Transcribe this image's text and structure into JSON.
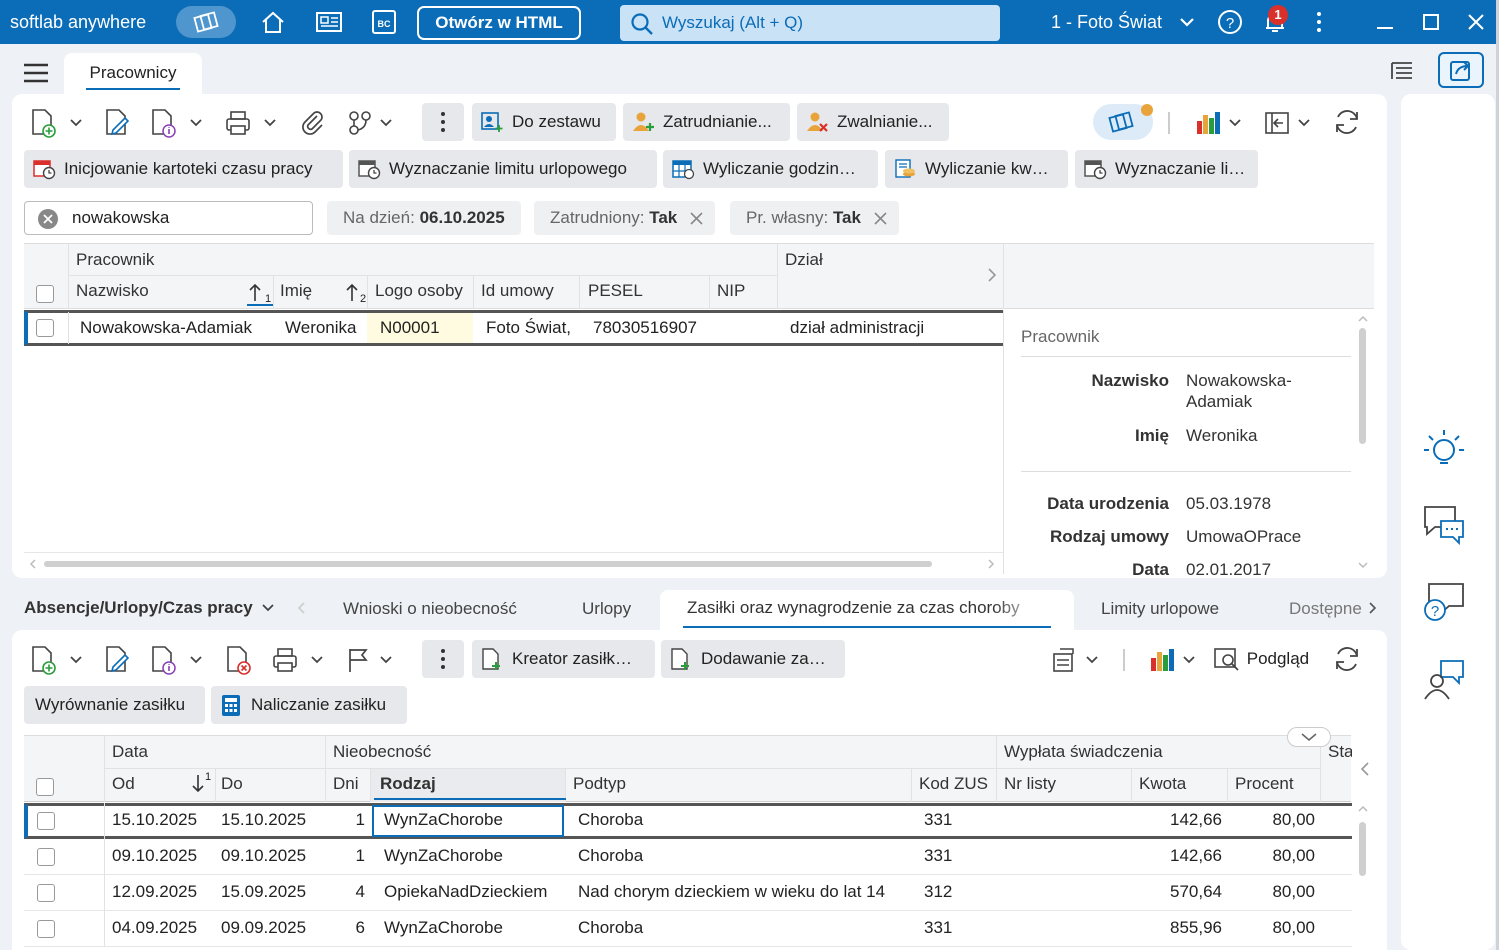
{
  "app": {
    "brand": "softlab anywhere",
    "open_html": "Otwórz w HTML",
    "search_placeholder": "Wyszukaj (Alt + Q)",
    "company": "1 - Foto Świat",
    "notifications": "1"
  },
  "tab": {
    "label": "Pracownicy"
  },
  "toolbar": {
    "do_zestawu": "Do zestawu",
    "zatrudnianie": "Zatrudnianie...",
    "zwalnianie": "Zwalnianie...",
    "actions": [
      "Inicjowanie kartoteki czasu pracy",
      "Wyznaczanie limitu urlopowego",
      "Wyliczanie godzin…",
      "Wyliczanie kw…",
      "Wyznaczanie li…"
    ]
  },
  "filters": {
    "search_value": "nowakowska",
    "na_dzien_label": "Na dzień:",
    "na_dzien_value": "06.10.2025",
    "zatrudniony_label": "Zatrudniony:",
    "zatrudniony_value": "Tak",
    "wlasny_label": "Pr. własny:",
    "wlasny_value": "Tak"
  },
  "grid": {
    "group_pracownik": "Pracownik",
    "group_dzial": "Dział",
    "cols": [
      "Nazwisko",
      "Imię",
      "Logo osoby",
      "Id umowy",
      "PESEL",
      "NIP"
    ],
    "sort1": "1",
    "sort2": "2",
    "row": {
      "nazwisko": "Nowakowska-Adamiak",
      "imie": "Weronika",
      "logo": "N00001",
      "umowa": "Foto Świat,",
      "pesel": "78030516907",
      "nip": "",
      "dzial": "dział administracji"
    }
  },
  "details": {
    "section": "Pracownik",
    "nazwisko_k": "Nazwisko",
    "nazwisko_v1": "Nowakowska-",
    "nazwisko_v2": "Adamiak",
    "imie_k": "Imię",
    "imie_v": "Weronika",
    "ur_k": "Data urodzenia",
    "ur_v": "05.03.1978",
    "umowa_k": "Rodzaj umowy",
    "umowa_v": "UmowaOPrace",
    "data_k": "Data",
    "data_v": "02.01.2017"
  },
  "lower_tabs": {
    "section": "Absencje/Urlopy/Czas pracy",
    "tabs": [
      "Wnioski o nieobecność",
      "Urlopy",
      "Zasiłki oraz wynagrodzenie za czas choroby",
      "Limity urlopowe",
      "Dostępne"
    ]
  },
  "lower_toolbar": {
    "kreator": "Kreator zasiłk…",
    "dodawanie": "Dodawanie za…",
    "podglad": "Podgląd",
    "wyrownanie": "Wyrównanie zasiłku",
    "naliczanie": "Naliczanie zasiłku"
  },
  "lgrid": {
    "g_data": "Data",
    "g_nieob": "Nieobecność",
    "g_wyplata": "Wypłata świadczenia",
    "g_sta": "Sta",
    "cols": [
      "Od",
      "Do",
      "Dni",
      "Rodzaj",
      "Podtyp",
      "Kod ZUS",
      "Nr listy",
      "Kwota",
      "Procent"
    ],
    "sort1": "1",
    "rows": [
      {
        "od": "15.10.2025",
        "do": "15.10.2025",
        "dni": "1",
        "rodzaj": "WynZaChorobe",
        "podtyp": "Choroba",
        "zus": "331",
        "nr": "",
        "kwota": "142,66",
        "procent": "80,00"
      },
      {
        "od": "09.10.2025",
        "do": "09.10.2025",
        "dni": "1",
        "rodzaj": "WynZaChorobe",
        "podtyp": "Choroba",
        "zus": "331",
        "nr": "",
        "kwota": "142,66",
        "procent": "80,00"
      },
      {
        "od": "12.09.2025",
        "do": "15.09.2025",
        "dni": "4",
        "rodzaj": "OpiekaNadDzieckiem",
        "podtyp": "Nad chorym dzieckiem w wieku do lat 14",
        "zus": "312",
        "nr": "",
        "kwota": "570,64",
        "procent": "80,00"
      },
      {
        "od": "04.09.2025",
        "do": "09.09.2025",
        "dni": "6",
        "rodzaj": "WynZaChorobe",
        "podtyp": "Choroba",
        "zus": "331",
        "nr": "",
        "kwota": "855,96",
        "procent": "80,00"
      }
    ]
  },
  "colors": {
    "brand": "#0b6db8",
    "selection": "#0b6db8",
    "highlight": "#fffbe0"
  }
}
